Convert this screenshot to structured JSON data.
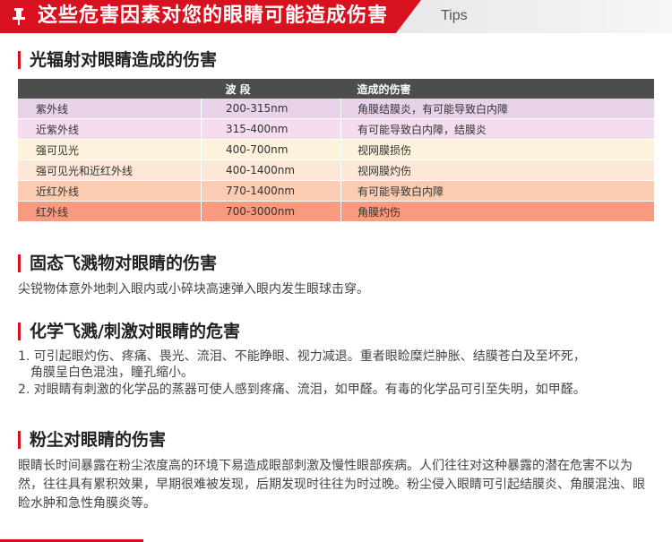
{
  "banner": {
    "title": "这些危害因素对您的眼睛可能造成伤害",
    "tips": "Tips",
    "accent": "#d8111f"
  },
  "section1": {
    "title": "光辐射对眼睛造成的伤害",
    "table": {
      "headers": [
        "",
        "波 段",
        "造成的伤害"
      ],
      "rows": [
        {
          "name": "紫外线",
          "band": "200-315nm",
          "harm": "角膜结膜炎，有可能导致白内障",
          "color": "#e8d2ea"
        },
        {
          "name": "近紫外线",
          "band": "315-400nm",
          "harm": "有可能导致白内障，结膜炎",
          "color": "#f5dcef"
        },
        {
          "name": "强可见光",
          "band": "400-700nm",
          "harm": "视网膜损伤",
          "color": "#fdf3dc"
        },
        {
          "name": "强可见光和近红外线",
          "band": "400-1400nm",
          "harm": "视网膜灼伤",
          "color": "#fde8d8"
        },
        {
          "name": "近红外线",
          "band": "770-1400nm",
          "harm": "有可能导致白内障",
          "color": "#fcccb2"
        },
        {
          "name": "红外线",
          "band": "700-3000nm",
          "harm": "角膜灼伤",
          "color": "#f99a7e"
        }
      ]
    }
  },
  "section2": {
    "title": "固态飞溅物对眼睛的伤害",
    "body": "尖锐物体意外地刺入眼内或小碎块高速弹入眼内发生眼球击穿。"
  },
  "section3": {
    "title": "化学飞溅/刺激对眼睛的危害",
    "items": [
      "1. 可引起眼灼伤、疼痛、畏光、流泪、不能睁眼、视力减退。重者眼睑糜烂肿胀、结膜苍白及至坏死，",
      "角膜呈白色混浊，瞳孔缩小。",
      "2. 对眼睛有刺激的化学品的蒸器可使人感到疼痛、流泪，如甲醛。有毒的化学品可引至失明，如甲醛。"
    ]
  },
  "section4": {
    "title": "粉尘对眼睛的伤害",
    "body": "眼睛长时间暴露在粉尘浓度高的环境下易造成眼部刺激及慢性眼部疾病。人们往往对这种暴露的潜在危害不以为然，往往具有累积效果，早期很难被发现，后期发现时往往为时过晚。粉尘侵入眼睛可引起结膜炎、角膜混浊、眼睑水肿和急性角膜炎等。"
  }
}
